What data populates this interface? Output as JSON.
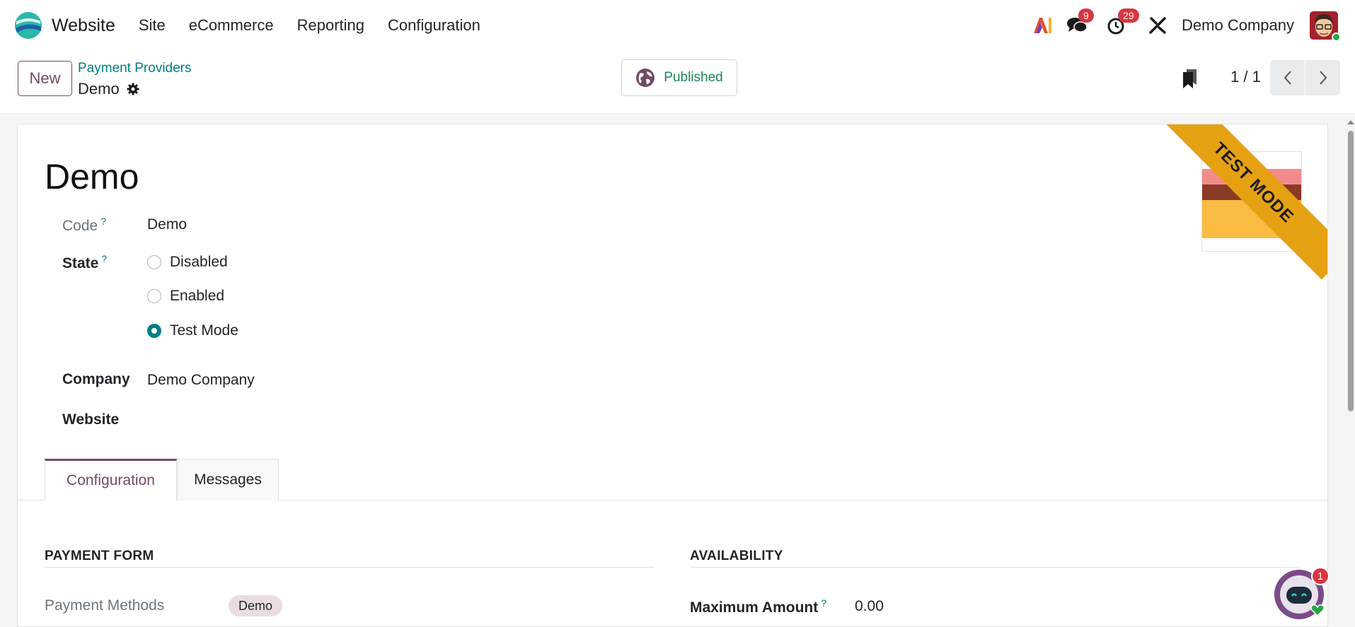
{
  "navbar": {
    "app_name": "Website",
    "menu": [
      "Site",
      "eCommerce",
      "Reporting",
      "Configuration"
    ],
    "messages_count": "9",
    "activities_count": "29",
    "company": "Demo Company"
  },
  "control": {
    "new_label": "New",
    "breadcrumb_parent": "Payment Providers",
    "record_name": "Demo",
    "published_label": "Published",
    "pager": "1 / 1"
  },
  "form": {
    "title": "Demo",
    "ribbon": "TEST MODE",
    "code_label": "Code",
    "code_value": "Demo",
    "state_label": "State",
    "state_options": [
      "Disabled",
      "Enabled",
      "Test Mode"
    ],
    "state_selected": "Test Mode",
    "company_label": "Company",
    "company_value": "Demo Company",
    "website_label": "Website",
    "help_mark": "?"
  },
  "tabs": [
    "Configuration",
    "Messages"
  ],
  "configuration": {
    "payment_form_title": "PAYMENT FORM",
    "payment_methods_label": "Payment Methods",
    "payment_methods_tag": "Demo",
    "availability_title": "AVAILABILITY",
    "max_amount_label": "Maximum Amount",
    "max_amount_value": "0.00"
  },
  "chat": {
    "badge": "1"
  },
  "colors": {
    "accent": "#714b67",
    "teal": "#017e84",
    "ribbon": "#e6a112",
    "badge": "#d9363e"
  }
}
